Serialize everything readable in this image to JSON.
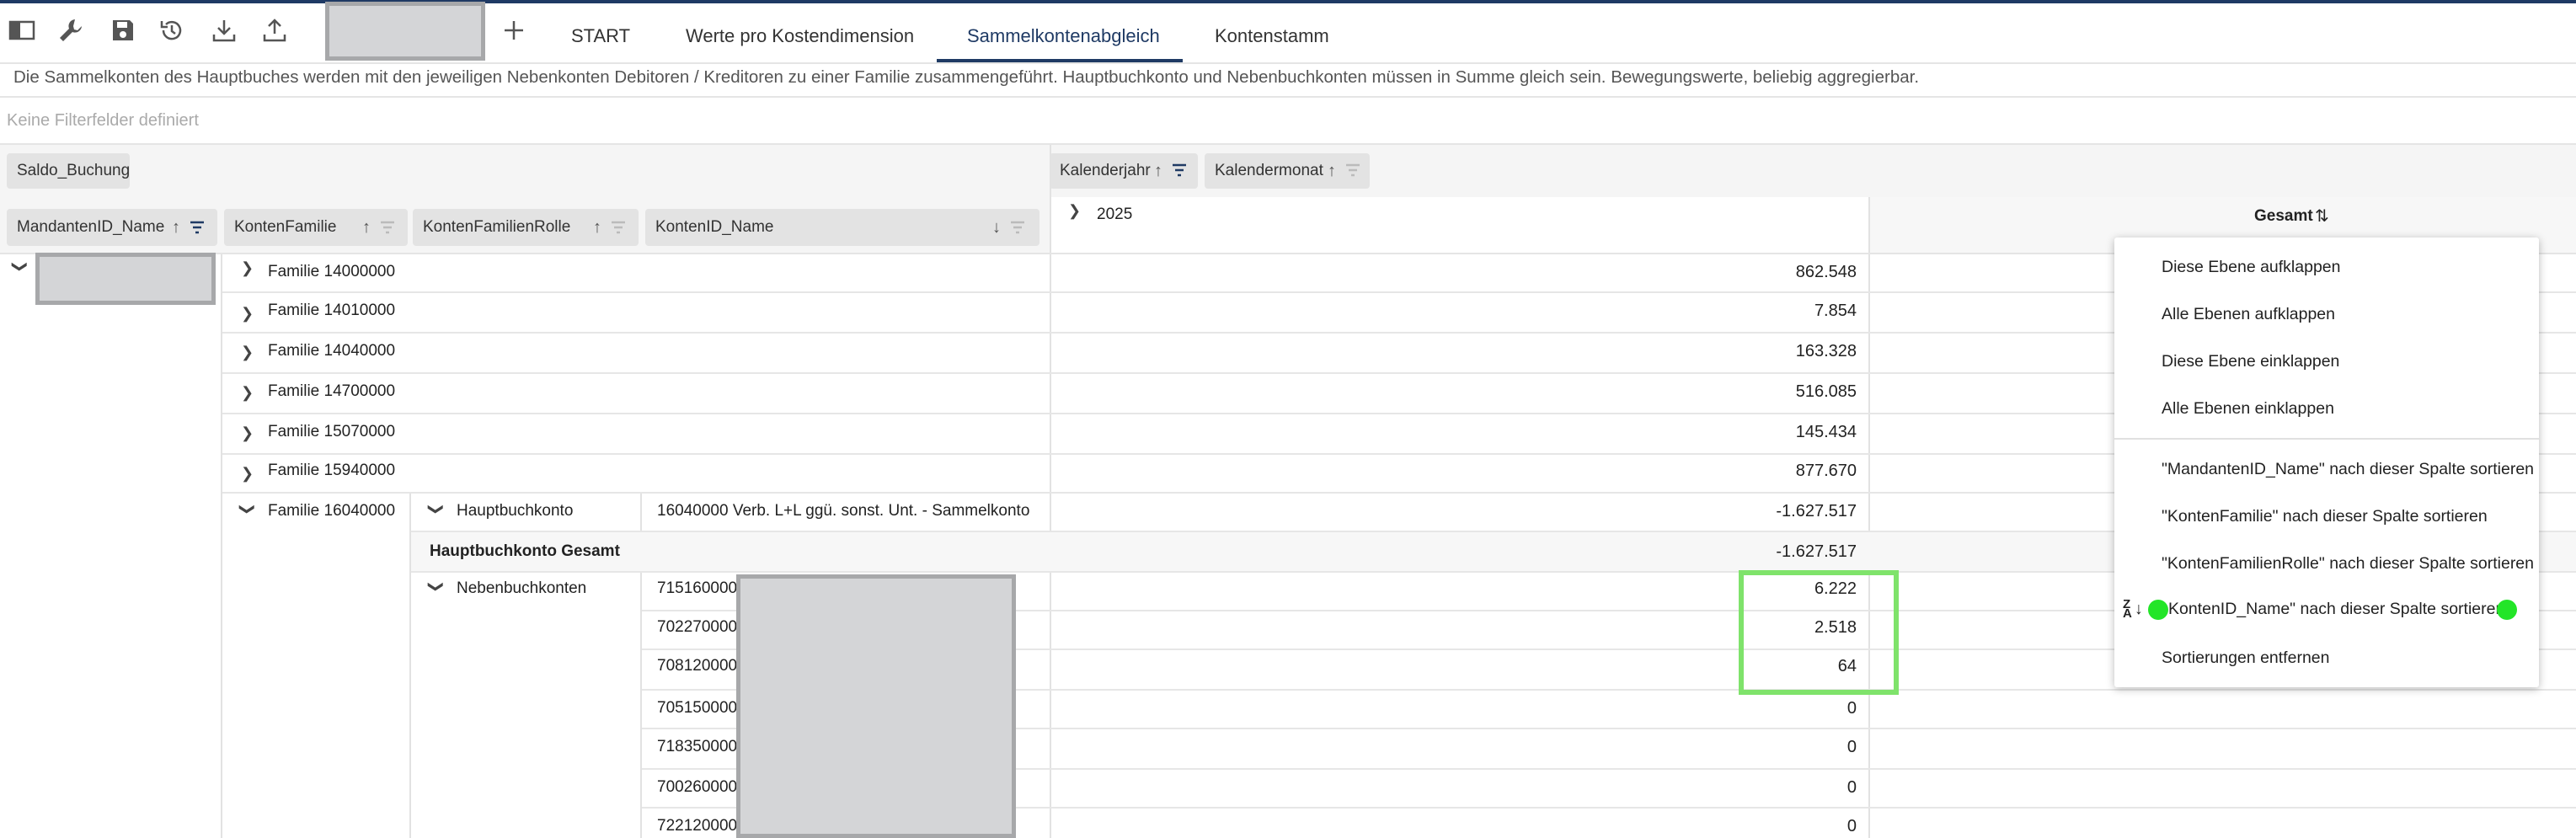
{
  "toolbar": {
    "icons": [
      "panel-icon",
      "wrench-icon",
      "save-icon",
      "history-icon",
      "download-icon",
      "upload-icon",
      "plus-icon"
    ],
    "tabs": [
      {
        "label": "START"
      },
      {
        "label": "Werte pro Kostendimension"
      },
      {
        "label": "Sammelkontenabgleich",
        "active": true
      },
      {
        "label": "Kontenstamm"
      }
    ]
  },
  "description": "Die Sammelkonten des Hauptbuches werden mit den jeweiligen Nebenkonten Debitoren / Kreditoren zu einer Familie zusammengeführt. Hauptbuchkonto und Nebenbuchkonten müssen in Summe gleich sein. Bewegungswerte, beliebig aggregierbar.",
  "filter_placeholder": "Keine Filterfelder definiert",
  "pivot": {
    "data_field": "Saldo_Buchung",
    "column_fields": [
      "Kalenderjahr",
      "Kalendermonat"
    ],
    "row_fields": [
      "MandantenID_Name",
      "KontenFamilie",
      "KontenFamilienRolle",
      "KontenID_Name"
    ],
    "year": "2025",
    "total_header": "Gesamt"
  },
  "rows": {
    "families": [
      {
        "label": "Familie 14000000",
        "value": "862.548"
      },
      {
        "label": "Familie 14010000",
        "value": "7.854"
      },
      {
        "label": "Familie 14040000",
        "value": "163.328"
      },
      {
        "label": "Familie 14700000",
        "value": "516.085"
      },
      {
        "label": "Familie 15070000",
        "value": "145.434"
      },
      {
        "label": "Familie 15940000",
        "value": "877.670"
      }
    ],
    "expanded_family": "Familie 16040000",
    "hauptbuch_role": "Hauptbuchkonto",
    "hauptbuch_account": "16040000 Verb. L+L ggü. sonst. Unt. - Sammelkonto",
    "hauptbuch_value": "-1.627.517",
    "hauptbuch_total_label": "Hauptbuchkonto Gesamt",
    "hauptbuch_total_value": "-1.627.517",
    "nebenbuch_role": "Nebenbuchkonten",
    "nebenbuch_accounts": [
      {
        "label": "715160000",
        "value": "6.222"
      },
      {
        "label": "702270000",
        "value": "2.518"
      },
      {
        "label": "708120000",
        "value": "64"
      },
      {
        "label": "705150000",
        "value": "0"
      },
      {
        "label": "718350000",
        "value": "0"
      },
      {
        "label": "700260000",
        "value": "0"
      },
      {
        "label": "722120000",
        "value": "0"
      }
    ]
  },
  "context_menu": {
    "items": [
      "Diese Ebene aufklappen",
      "Alle Ebenen aufklappen",
      "Diese Ebene einklappen",
      "Alle Ebenen einklappen",
      "\"MandantenID_Name\" nach dieser Spalte sortieren",
      "\"KontenFamilie\" nach dieser Spalte sortieren",
      "\"KontenFamilienRolle\" nach dieser Spalte sortieren",
      "KontenID_Name\" nach dieser Spalte sortieren",
      "Sortierungen entfernen"
    ]
  },
  "colors": {
    "accent": "#1f3a64",
    "highlight": "#7fe36b",
    "marker": "#23e528"
  }
}
